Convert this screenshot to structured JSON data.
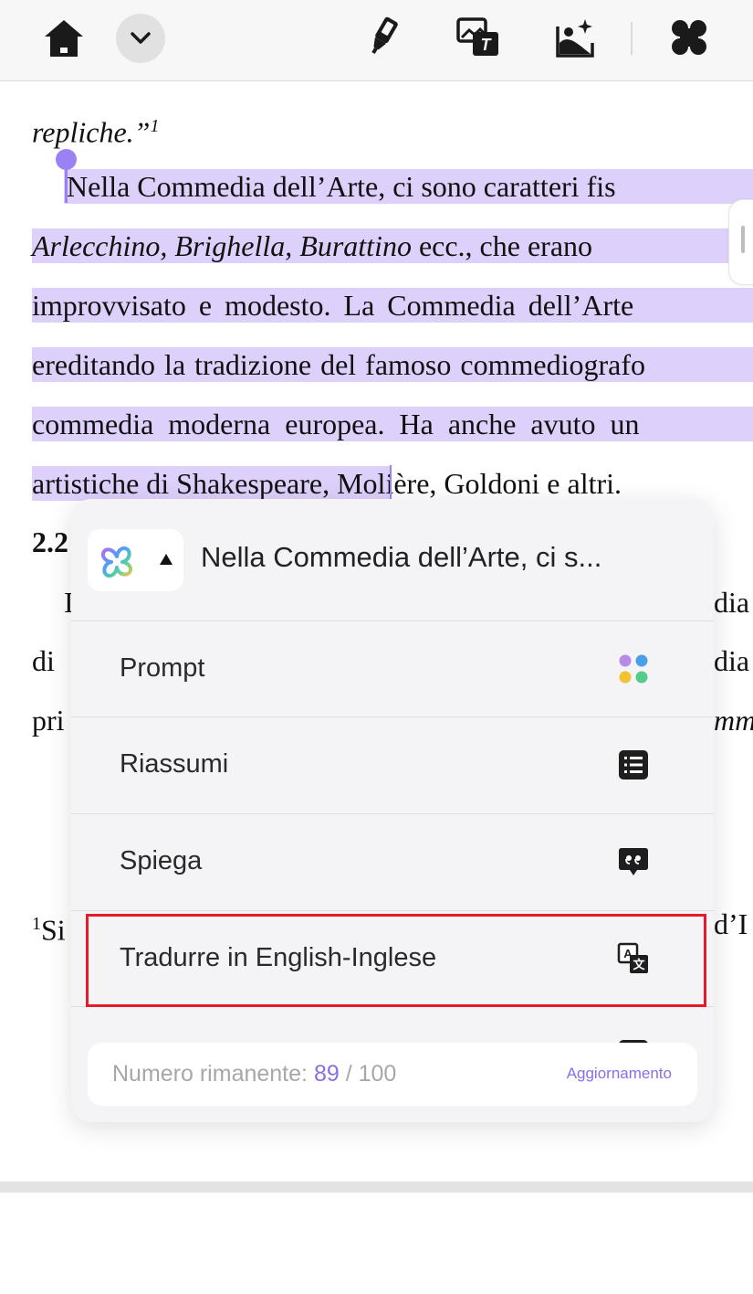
{
  "toolbar": {
    "buttons": [
      "home-icon",
      "chevron-down-icon",
      "highlighter-icon",
      "image-translate-icon",
      "image-ai-icon",
      "apps-grid-icon"
    ]
  },
  "document": {
    "line_0_tail": "repliche.”",
    "line_0_sup": "1",
    "lines": [
      "Nella Commedia dell’Arte, ci sono caratteri fis",
      "Arlecchino, Brighella, Burattino",
      "ecc., che erano",
      "improvvisato e modesto. La Commedia dell’Arte",
      "ereditando la tradizione del famoso commediografo",
      "commedia moderna europea. Ha anche avuto un",
      "artistiche di Shakespeare, ",
      "Molière, Goldoni e altri."
    ],
    "left_fragments": [
      "2.2",
      "I",
      "di",
      "pri",
      "Si"
    ],
    "left_sup": "1",
    "right_fragments": [
      "dia",
      "dia",
      "mm",
      "d’I"
    ]
  },
  "popup": {
    "title": "Nella Commedia dell’Arte, ci s...",
    "items": [
      {
        "label": "Prompt",
        "icon": "colored-dots-icon"
      },
      {
        "label": "Riassumi",
        "icon": "list-icon"
      },
      {
        "label": "Spiega",
        "icon": "quote-bubble-icon"
      },
      {
        "label": "Tradurre in English-Inglese",
        "icon": "translate-icon"
      }
    ],
    "quota": {
      "label": "Numero rimanente: ",
      "remaining": "89",
      "separator": " / ",
      "total": "100",
      "upgrade": "Aggiornamento"
    }
  },
  "colors": {
    "selection": "#ddd0fb",
    "accent": "#8a6fe5",
    "highlight_frame": "#e41c2a"
  }
}
